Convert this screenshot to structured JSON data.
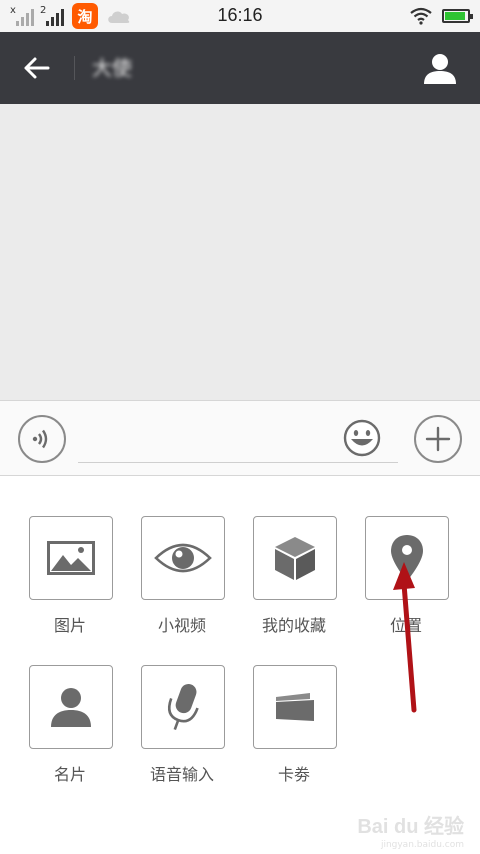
{
  "status_bar": {
    "sim1_label": "x",
    "sim2_label": "2",
    "taobao_glyph": "淘",
    "time": "16:16",
    "battery_level": 0.9,
    "colors": {
      "battery": "#2fc433",
      "taobao": "#ff5a00"
    }
  },
  "header": {
    "title": "大使",
    "back_icon": "arrow-left-icon",
    "contact_icon": "person-icon",
    "background": "#393a3f"
  },
  "input_bar": {
    "voice_icon": "voice-icon",
    "emoji_icon": "smiley-icon",
    "plus_icon": "plus-icon",
    "message_value": ""
  },
  "panel": {
    "items": [
      {
        "label": "图片",
        "icon": "image-icon"
      },
      {
        "label": "小视频",
        "icon": "eye-icon"
      },
      {
        "label": "我的收藏",
        "icon": "cube-icon"
      },
      {
        "label": "位置",
        "icon": "location-pin-icon"
      },
      {
        "label": "名片",
        "icon": "person-card-icon"
      },
      {
        "label": "语音输入",
        "icon": "microphone-icon"
      },
      {
        "label": "卡劵",
        "icon": "card-icon"
      }
    ]
  },
  "watermark": {
    "text": "Bai du 经验",
    "sub": "jingyan.baidu.com"
  },
  "annotation": {
    "color": "#b01217"
  }
}
